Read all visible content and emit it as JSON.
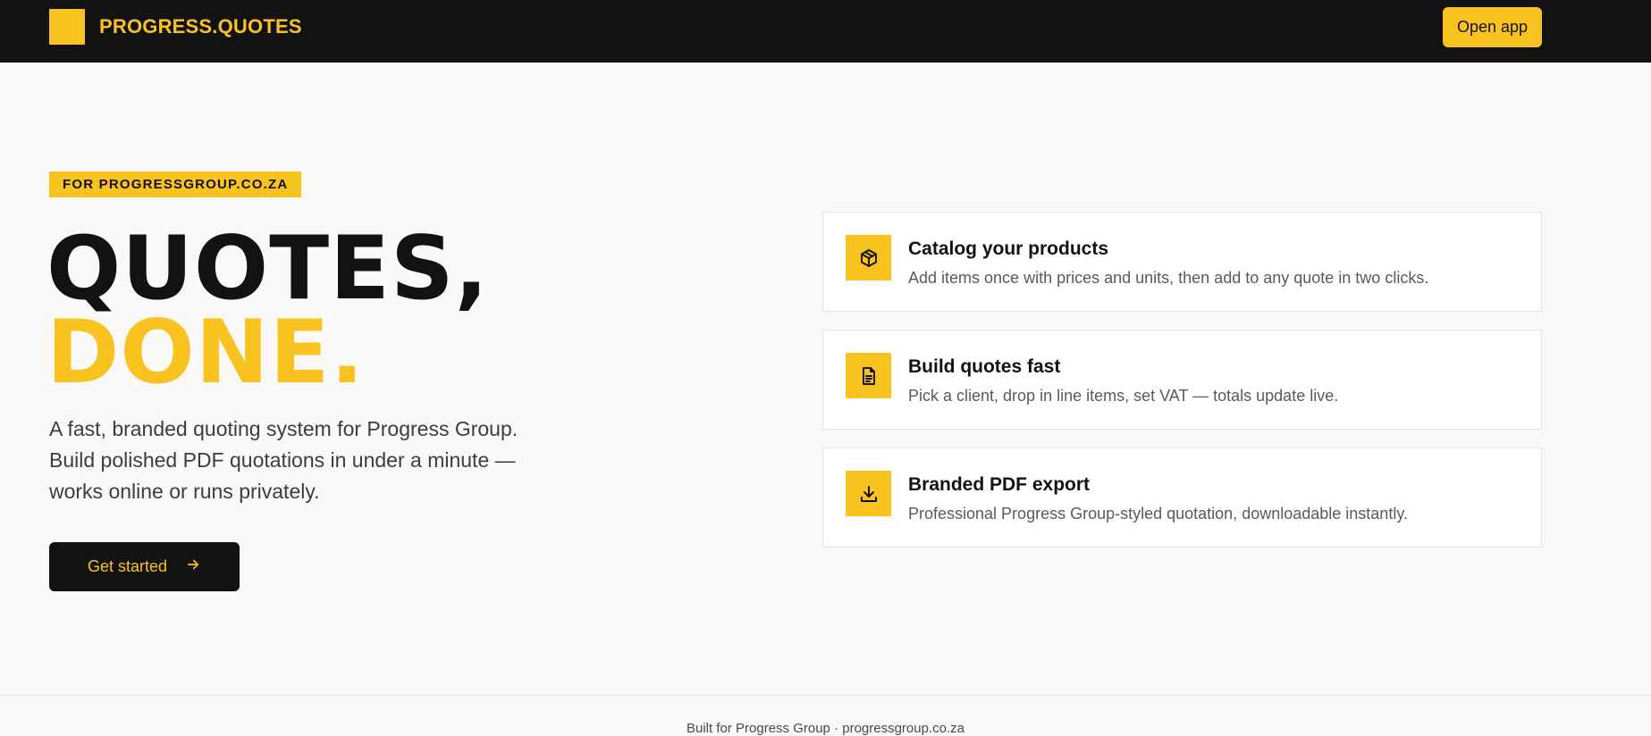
{
  "header": {
    "brand": "PROGRESS.QUOTES",
    "open_app": "Open app"
  },
  "hero": {
    "tag": "FOR PROGRESSGROUP.CO.ZA",
    "line1": "QUOTES,",
    "line2": "DONE.",
    "desc_line1": "A fast, branded quoting system for Progress Group.",
    "desc_line2": "Build polished PDF quotations in under a minute —",
    "desc_line3": "works online or runs privately.",
    "cta": "Get started"
  },
  "features": [
    {
      "icon": "box-icon",
      "title": "Catalog your products",
      "text": "Add items once with prices and units, then add to any quote in two clicks."
    },
    {
      "icon": "document-icon",
      "title": "Build quotes fast",
      "text": "Pick a client, drop in line items, set VAT — totals update live."
    },
    {
      "icon": "download-icon",
      "title": "Branded PDF export",
      "text": "Professional Progress Group-styled quotation, downloadable instantly."
    }
  ],
  "footer": {
    "text": "Built for Progress Group · progressgroup.co.za"
  },
  "colors": {
    "accent": "#f8c31f",
    "dark": "#121212",
    "background": "#faf9f7"
  }
}
